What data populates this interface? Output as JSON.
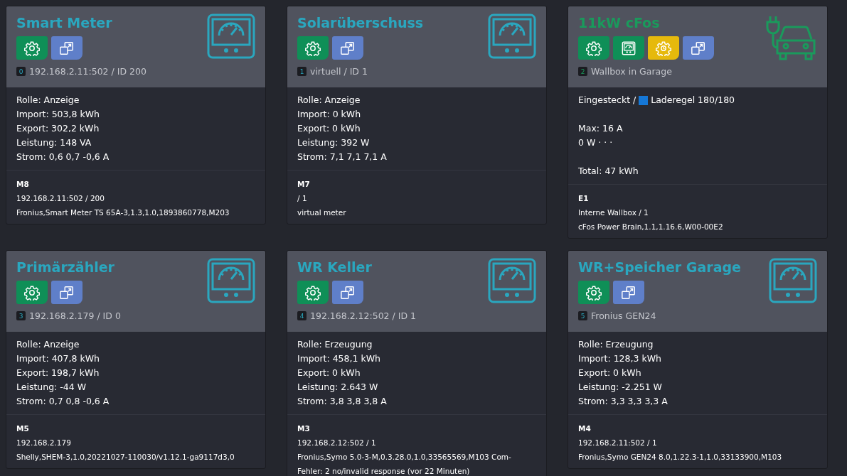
{
  "cards": [
    {
      "kind": "meter",
      "title": "Smart Meter",
      "buttons": [
        {
          "kind": "settings"
        },
        {
          "kind": "copy"
        }
      ],
      "index": "0",
      "address": "192.168.2.11:502 / ID 200",
      "groups": [
        [
          "Rolle: Anzeige",
          "Import: 503,8 kWh",
          "Export: 302,2 kWh",
          "Leistung: 148 VA",
          "Strom: 0,6 0,7 -0,6 A"
        ]
      ],
      "footer": {
        "code": "M8",
        "lines": [
          "192.168.2.11:502 / 200",
          "Fronius,Smart Meter TS 65A-3,1.3,1.0,1893860778,M203"
        ]
      }
    },
    {
      "kind": "meter",
      "title": "Solarüberschuss",
      "buttons": [
        {
          "kind": "settings"
        },
        {
          "kind": "copy"
        }
      ],
      "index": "1",
      "address": "virtuell / ID 1",
      "groups": [
        [
          "Rolle: Anzeige",
          "Import: 0 kWh",
          "Export: 0 kWh",
          "Leistung: 392 W",
          "Strom: 7,1 7,1 7,1 A"
        ]
      ],
      "footer": {
        "code": "M7",
        "lines": [
          "/ 1",
          "virtual meter"
        ]
      }
    },
    {
      "kind": "wallbox",
      "title": "11kW cFos",
      "buttons": [
        {
          "kind": "settings"
        },
        {
          "kind": "meter"
        },
        {
          "kind": "timer-settings"
        },
        {
          "kind": "copy"
        }
      ],
      "index": "2",
      "address": "Wallbox in Garage",
      "status": {
        "plug": "Eingesteckt /",
        "rule": "Laderegel 180/180"
      },
      "groups": [
        [
          "Max: 16 A",
          "0 W · · ·"
        ],
        [
          "Total: 47 kWh"
        ]
      ],
      "footer": {
        "code": "E1",
        "lines": [
          "Interne Wallbox / 1",
          "cFos Power Brain,1.1,1.16.6,W00-00E2"
        ]
      }
    },
    {
      "kind": "meter",
      "title": "Primärzähler",
      "buttons": [
        {
          "kind": "settings"
        },
        {
          "kind": "copy"
        }
      ],
      "index": "3",
      "address": "192.168.2.179 / ID 0",
      "groups": [
        [
          "Rolle: Anzeige",
          "Import: 407,8 kWh",
          "Export: 198,7 kWh",
          "Leistung: -44 W",
          "Strom: 0,7 0,8 -0,6 A"
        ]
      ],
      "footer": {
        "code": "M5",
        "lines": [
          "192.168.2.179",
          "Shelly,SHEM-3,1.0,20221027-110030/v1.12.1-ga9117d3,0"
        ]
      }
    },
    {
      "kind": "meter",
      "title": "WR Keller",
      "buttons": [
        {
          "kind": "settings"
        },
        {
          "kind": "copy"
        }
      ],
      "index": "4",
      "address": "192.168.2.12:502 / ID 1",
      "groups": [
        [
          "Rolle: Erzeugung",
          "Import: 458,1 kWh",
          "Export: 0 kWh",
          "Leistung: 2.643 W",
          "Strom: 3,8 3,8 3,8 A"
        ]
      ],
      "footer": {
        "code": "M3",
        "lines": [
          "192.168.2.12:502 / 1",
          "Fronius,Symo 5.0-3-M,0.3.28.0,1.0,33565569,M103 Com-Fehler: 2 no/invalid response (vor 22 Minuten)"
        ]
      }
    },
    {
      "kind": "meter",
      "title": "WR+Speicher Garage",
      "buttons": [
        {
          "kind": "settings"
        },
        {
          "kind": "copy"
        }
      ],
      "index": "5",
      "address": "Fronius GEN24",
      "groups": [
        [
          "Rolle: Erzeugung",
          "Import: 128,3 kWh",
          "Export: 0 kWh",
          "Leistung: -2.251 W",
          "Strom: 3,3 3,3 3,3 A"
        ]
      ],
      "footer": {
        "code": "M4",
        "lines": [
          "192.168.2.11:502 / 1",
          "Fronius,Symo GEN24 8.0,1.22.3-1,1.0,33133900,M103"
        ]
      }
    }
  ]
}
